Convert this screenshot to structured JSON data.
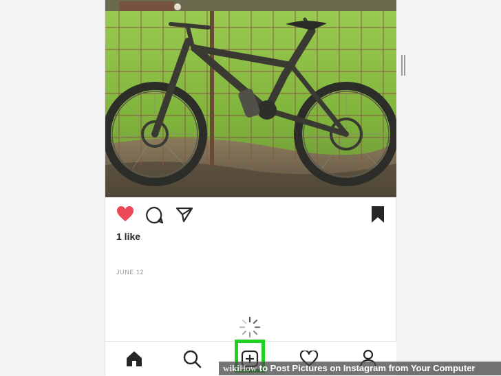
{
  "post": {
    "likes_label": "1 like",
    "date_label": "JUNE 12",
    "liked": true,
    "saved": true
  },
  "actions": {
    "like_icon": "heart-filled-icon",
    "comment_icon": "comment-icon",
    "share_icon": "paper-plane-icon",
    "save_icon": "bookmark-icon"
  },
  "nav": {
    "items": [
      {
        "name": "home",
        "icon": "home-icon"
      },
      {
        "name": "search",
        "icon": "search-icon"
      },
      {
        "name": "new-post",
        "icon": "plus-square-icon",
        "highlighted": true
      },
      {
        "name": "activity",
        "icon": "heart-outline-icon"
      },
      {
        "name": "profile",
        "icon": "person-icon"
      }
    ]
  },
  "watermark": {
    "brand_prefix": "wiki",
    "brand_suffix": "How",
    "title": "to Post Pictures on Instagram from Your Computer"
  },
  "colors": {
    "like_red": "#ed4956",
    "text_dark": "#262626",
    "highlight_green": "#22d022",
    "muted": "#999999"
  }
}
